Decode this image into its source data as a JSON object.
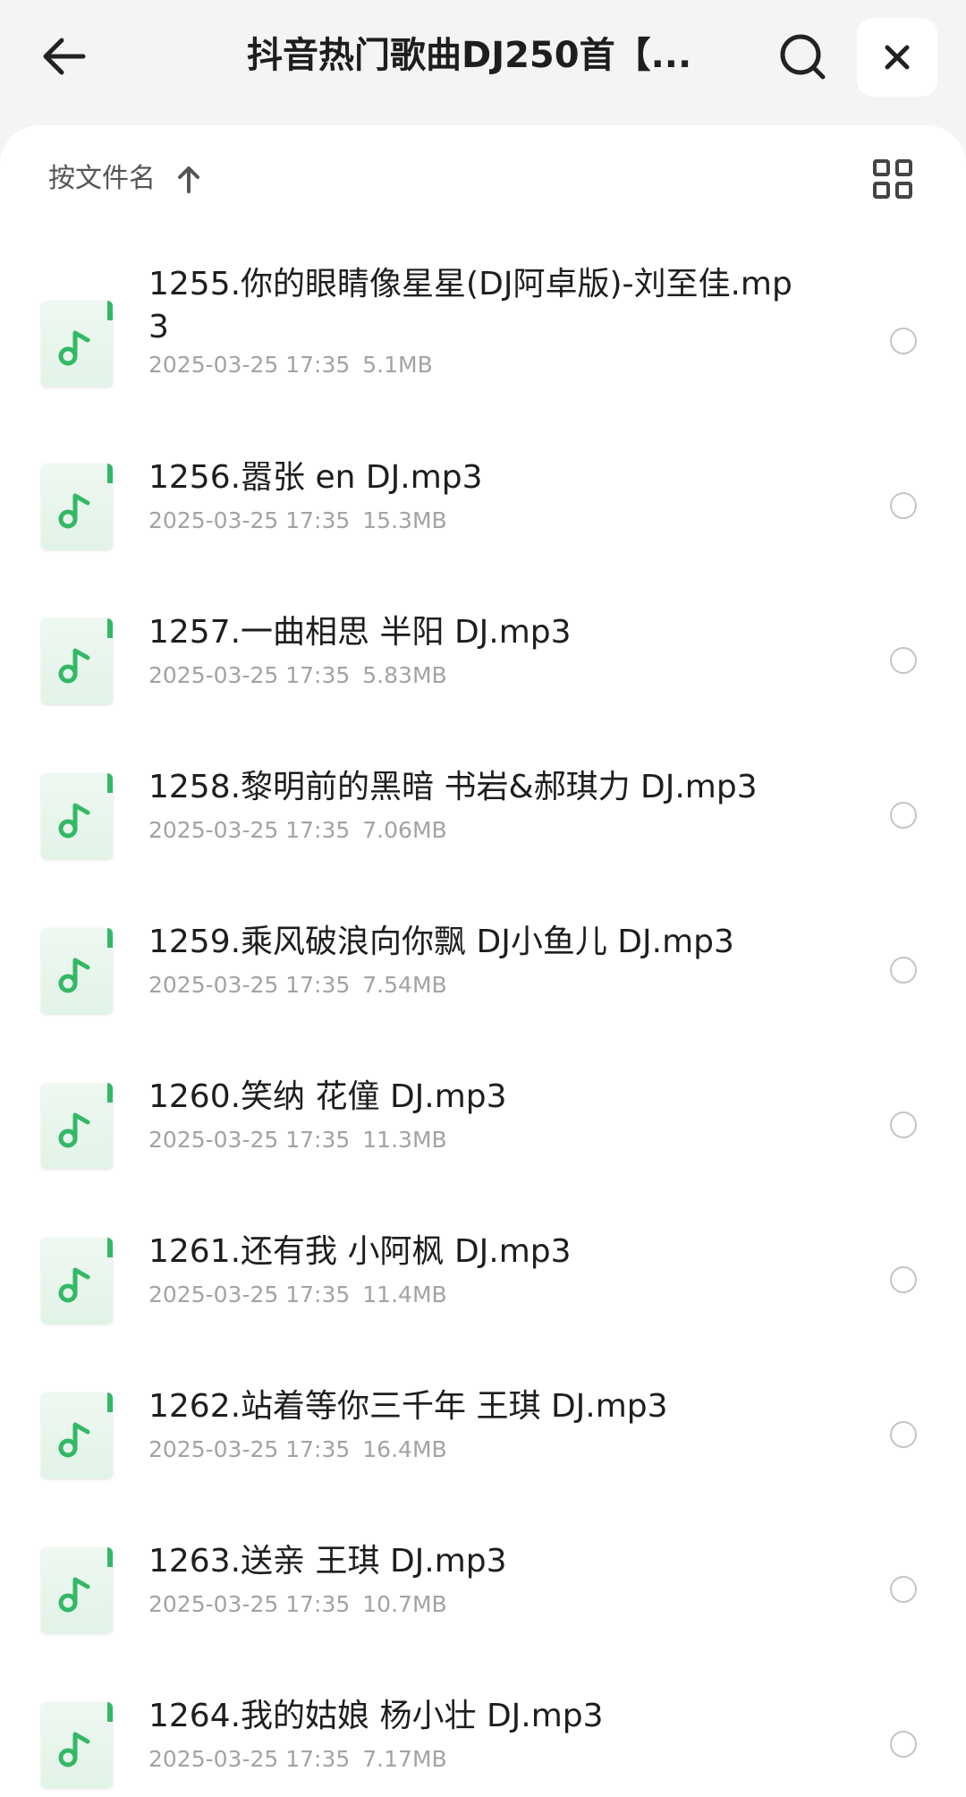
{
  "header": {
    "title": "抖音热门歌曲DJ250首【...",
    "back_icon": "arrow-left-icon",
    "search_icon": "search-icon",
    "close_icon": "close-icon"
  },
  "sortbar": {
    "label": "按文件名",
    "sort_icon": "arrow-up-icon",
    "view_icon": "grid-view-icon"
  },
  "files": [
    {
      "name": "1255.你的眼睛像星星(DJ阿卓版)-刘至佳.mp3",
      "date": "2025-03-25 17:35",
      "size": "5.1MB"
    },
    {
      "name": "1256.嚣张 en DJ.mp3",
      "date": "2025-03-25 17:35",
      "size": "15.3MB"
    },
    {
      "name": "1257.一曲相思 半阳 DJ.mp3",
      "date": "2025-03-25 17:35",
      "size": "5.83MB"
    },
    {
      "name": "1258.黎明前的黑暗 书岩&郝琪力 DJ.mp3",
      "date": "2025-03-25 17:35",
      "size": "7.06MB"
    },
    {
      "name": "1259.乘风破浪向你飘 DJ小鱼儿 DJ.mp3",
      "date": "2025-03-25 17:35",
      "size": "7.54MB"
    },
    {
      "name": "1260.笑纳 花僮 DJ.mp3",
      "date": "2025-03-25 17:35",
      "size": "11.3MB"
    },
    {
      "name": "1261.还有我 小阿枫 DJ.mp3",
      "date": "2025-03-25 17:35",
      "size": "11.4MB"
    },
    {
      "name": "1262.站着等你三千年 王琪 DJ.mp3",
      "date": "2025-03-25 17:35",
      "size": "16.4MB"
    },
    {
      "name": "1263.送亲 王琪 DJ.mp3",
      "date": "2025-03-25 17:35",
      "size": "10.7MB"
    },
    {
      "name": "1264.我的姑娘 杨小壮 DJ.mp3",
      "date": "2025-03-25 17:35",
      "size": "7.17MB"
    }
  ],
  "colors": {
    "accent": "#33b866",
    "icon_bg": "#e6f5ea",
    "meta_text": "#a3a3a3"
  }
}
